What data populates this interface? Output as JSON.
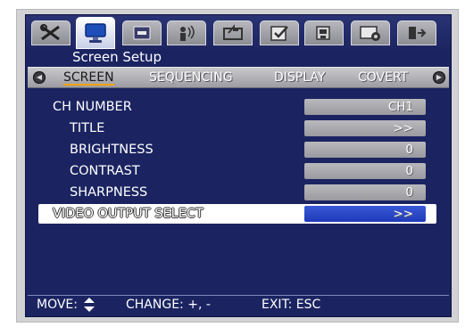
{
  "window": {
    "title": "Screen Setup"
  },
  "top_tabs": [
    {
      "icon": "tools-icon"
    },
    {
      "icon": "monitor-icon",
      "active": true
    },
    {
      "icon": "hdd-icon"
    },
    {
      "icon": "network-icon"
    },
    {
      "icon": "record-icon"
    },
    {
      "icon": "event-icon"
    },
    {
      "icon": "backup-icon"
    },
    {
      "icon": "system-icon"
    },
    {
      "icon": "exit-icon"
    }
  ],
  "subtabs": [
    {
      "label": "SCREEN",
      "active": true
    },
    {
      "label": "SEQUENCING"
    },
    {
      "label": "DISPLAY"
    },
    {
      "label": "COVERT"
    }
  ],
  "menu": {
    "rows": [
      {
        "label": "CH NUMBER",
        "value": "CH1"
      },
      {
        "label": "TITLE",
        "value": ">>"
      },
      {
        "label": "BRIGHTNESS",
        "value": "0"
      },
      {
        "label": "CONTRAST",
        "value": "0"
      },
      {
        "label": "SHARPNESS",
        "value": "0"
      },
      {
        "label": "VIDEO OUTPUT SELECT",
        "value": ">>",
        "selected": true
      }
    ]
  },
  "footer": {
    "move": "MOVE:",
    "change": "CHANGE: +, -",
    "exit": "EXIT: ESC"
  },
  "colors": {
    "screen_bg": "#1b2461",
    "tab_active": "#ffffff",
    "subtab_underline": "#f5a300",
    "selected_value": "#2a4ac8"
  }
}
